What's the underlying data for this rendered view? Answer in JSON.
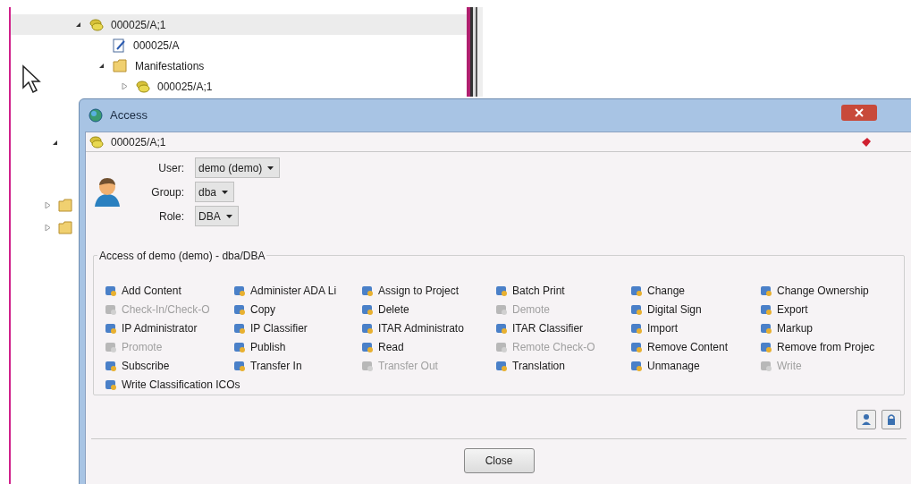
{
  "tree": [
    {
      "label": "000025/A;1",
      "selected": true,
      "expanded": true,
      "children": [
        {
          "label": "000025/A",
          "kind": "document"
        },
        {
          "label": "Manifestations",
          "kind": "folder",
          "expanded": true,
          "children": [
            {
              "label": "000025/A;1",
              "expanded": false
            }
          ]
        }
      ]
    }
  ],
  "dialog": {
    "title": "Access",
    "object": "000025/A;1",
    "fields": [
      {
        "label": "User:",
        "value": "demo (demo)"
      },
      {
        "label": "Group:",
        "value": "dba"
      },
      {
        "label": "Role:",
        "value": "DBA"
      }
    ],
    "group_title": "Access of demo (demo) - dba/DBA",
    "permissions": [
      {
        "label": "Add Content",
        "disabled": false
      },
      {
        "label": "Administer ADA Li",
        "disabled": false
      },
      {
        "label": "Assign to Project",
        "disabled": false
      },
      {
        "label": "Batch Print",
        "disabled": false
      },
      {
        "label": "Change",
        "disabled": false
      },
      {
        "label": "Change Ownership",
        "disabled": false
      },
      {
        "label": "Check-In/Check-O",
        "disabled": true
      },
      {
        "label": "Copy",
        "disabled": false
      },
      {
        "label": "Delete",
        "disabled": false
      },
      {
        "label": "Demote",
        "disabled": true
      },
      {
        "label": "Digital Sign",
        "disabled": false
      },
      {
        "label": "Export",
        "disabled": false
      },
      {
        "label": "IP Administrator",
        "disabled": false
      },
      {
        "label": "IP Classifier",
        "disabled": false
      },
      {
        "label": "ITAR Administrato",
        "disabled": false
      },
      {
        "label": "ITAR Classifier",
        "disabled": false
      },
      {
        "label": "Import",
        "disabled": false
      },
      {
        "label": "Markup",
        "disabled": false
      },
      {
        "label": "Promote",
        "disabled": true
      },
      {
        "label": "Publish",
        "disabled": false
      },
      {
        "label": "Read",
        "disabled": false
      },
      {
        "label": "Remote Check-O",
        "disabled": true
      },
      {
        "label": "Remove Content",
        "disabled": false
      },
      {
        "label": "Remove from Projec",
        "disabled": false
      },
      {
        "label": "Subscribe",
        "disabled": false
      },
      {
        "label": "Transfer In",
        "disabled": false
      },
      {
        "label": "Transfer Out",
        "disabled": true
      },
      {
        "label": "Translation",
        "disabled": false
      },
      {
        "label": "Unmanage",
        "disabled": false
      },
      {
        "label": "Write",
        "disabled": true
      },
      {
        "label": "Write Classification ICOs",
        "disabled": false
      }
    ],
    "close_button": "Close"
  }
}
